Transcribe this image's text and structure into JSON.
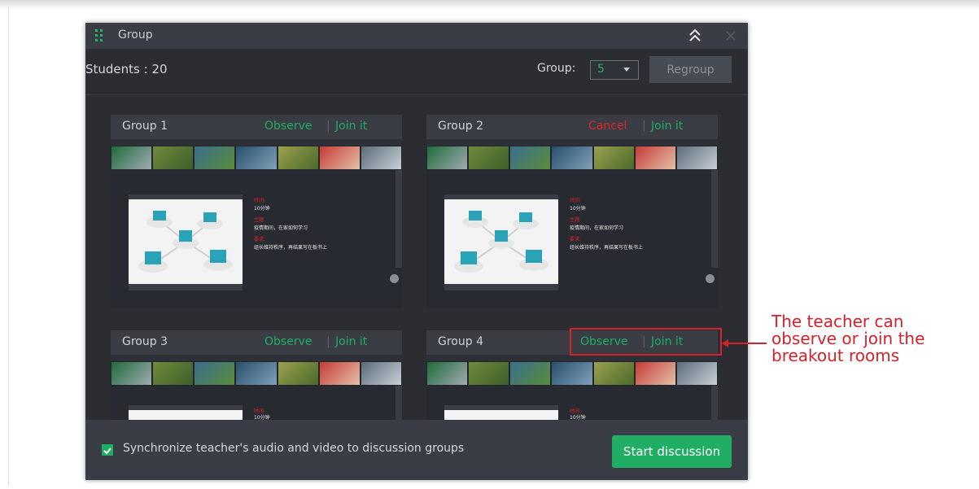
{
  "window": {
    "title": "Group",
    "students_label": "Students : ",
    "students_count": "20",
    "group_label": "Group:",
    "group_value": "5",
    "regroup_label": "Regroup"
  },
  "groups": [
    {
      "name": "Group 1",
      "actions": [
        {
          "label": "Observe",
          "color": "#1fae63"
        },
        {
          "label": "Join it",
          "color": "#1fae63"
        }
      ]
    },
    {
      "name": "Group 2",
      "actions": [
        {
          "label": "Cancel",
          "color": "#e0252b"
        },
        {
          "label": "Join it",
          "color": "#1fae63"
        }
      ]
    },
    {
      "name": "Group 3",
      "actions": [
        {
          "label": "Observe",
          "color": "#1fae63"
        },
        {
          "label": "Join it",
          "color": "#1fae63"
        }
      ]
    },
    {
      "name": "Group 4",
      "actions": [
        {
          "label": "Observe",
          "color": "#1fae63"
        },
        {
          "label": "Join it",
          "color": "#1fae63"
        }
      ]
    }
  ],
  "preview_notes": {
    "time_label": "时间:",
    "time_value": "10分钟",
    "topic_label": "主题:",
    "topic_value": "疫情期间，在家如何学习",
    "req_label": "要求:",
    "req_value": "组长维持秩序，再结果写在板书上"
  },
  "footer": {
    "sync_label": "Synchronize teacher's audio and video to discussion groups",
    "sync_checked": true,
    "start_label": "Start discussion"
  },
  "annotation": {
    "lines": [
      "The teacher can",
      "observe or join the",
      "breakout rooms"
    ]
  },
  "colors": {
    "accent": "#1fae63",
    "cancel": "#e0252b",
    "annotation": "#d6212b"
  }
}
